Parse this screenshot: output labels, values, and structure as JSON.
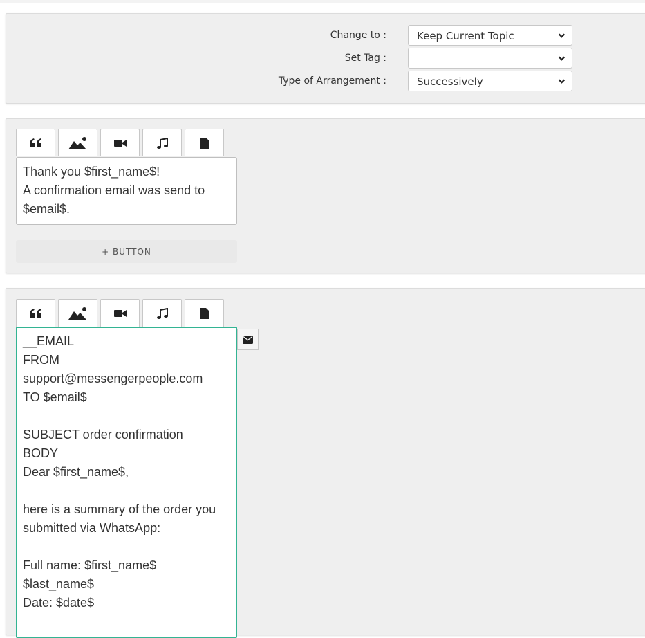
{
  "settings": {
    "change_to_label": "Change to :",
    "change_to_value": "Keep Current Topic",
    "set_tag_label": "Set Tag :",
    "set_tag_value": "",
    "arrangement_label": "Type of Arrangement :",
    "arrangement_value": "Successively"
  },
  "tabs": [
    {
      "icon": "quote-icon"
    },
    {
      "icon": "image-icon"
    },
    {
      "icon": "video-icon"
    },
    {
      "icon": "music-icon"
    },
    {
      "icon": "file-icon"
    }
  ],
  "message1": {
    "text": "Thank you $first_name$!\nA confirmation email was send to $email$."
  },
  "add_button_label": "+ BUTTON",
  "message2": {
    "text": "__EMAIL\nFROM\nsupport@messengerpeople.com\nTO $email$\n\nSUBJECT order confirmation\nBODY\nDear $first_name$,\n\nhere is a summary of the order you submitted via WhatsApp:\n\nFull name: $first_name$\n$last_name$\nDate: $date$",
    "side_icon": "envelope-icon"
  },
  "colors": {
    "active_border": "#33b493",
    "panel_bg": "#efefef"
  }
}
